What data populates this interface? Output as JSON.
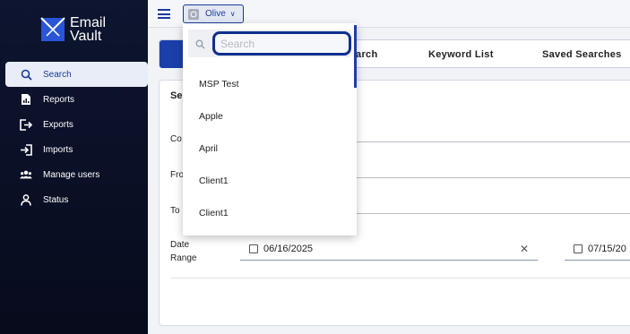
{
  "app": {
    "logo_line1": "Email",
    "logo_line2": "Vault"
  },
  "sidebar": {
    "items": [
      {
        "label": "Search",
        "icon": "search-icon",
        "active": true
      },
      {
        "label": "Reports",
        "icon": "reports-icon",
        "active": false
      },
      {
        "label": "Exports",
        "icon": "export-icon",
        "active": false
      },
      {
        "label": "Imports",
        "icon": "import-icon",
        "active": false
      },
      {
        "label": "Manage users",
        "icon": "users-icon",
        "active": false
      },
      {
        "label": "Status",
        "icon": "person-icon",
        "active": false
      }
    ]
  },
  "topbar": {
    "tenant_name": "Olive"
  },
  "tabs": {
    "items": [
      "Search",
      "Keyword List",
      "Saved Searches"
    ]
  },
  "form": {
    "title_partial": "Se",
    "contains_partial": "Co",
    "from_partial": "Fro",
    "to_partial": "To",
    "date_range_line1": "Date",
    "date_range_line2": "Range",
    "start_date": "06/16/2025",
    "end_date": "07/15/20"
  },
  "dropdown": {
    "search_placeholder": "Search",
    "options": [
      "MSP Test",
      "Apple",
      "April",
      "Client1",
      "Client1"
    ]
  },
  "colors": {
    "brand": "#1b3fa8",
    "sidebar_bg": "#0d1530",
    "active_nav_bg": "#e8edf7"
  }
}
